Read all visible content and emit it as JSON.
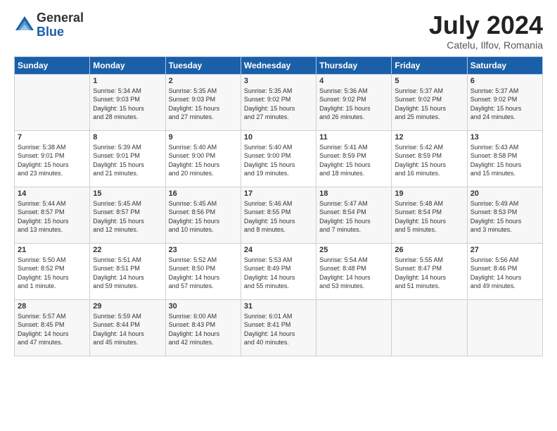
{
  "header": {
    "logo_general": "General",
    "logo_blue": "Blue",
    "month_title": "July 2024",
    "location": "Catelu, Ilfov, Romania"
  },
  "weekdays": [
    "Sunday",
    "Monday",
    "Tuesday",
    "Wednesday",
    "Thursday",
    "Friday",
    "Saturday"
  ],
  "weeks": [
    [
      {
        "day": "",
        "info": ""
      },
      {
        "day": "1",
        "info": "Sunrise: 5:34 AM\nSunset: 9:03 PM\nDaylight: 15 hours\nand 28 minutes."
      },
      {
        "day": "2",
        "info": "Sunrise: 5:35 AM\nSunset: 9:03 PM\nDaylight: 15 hours\nand 27 minutes."
      },
      {
        "day": "3",
        "info": "Sunrise: 5:35 AM\nSunset: 9:02 PM\nDaylight: 15 hours\nand 27 minutes."
      },
      {
        "day": "4",
        "info": "Sunrise: 5:36 AM\nSunset: 9:02 PM\nDaylight: 15 hours\nand 26 minutes."
      },
      {
        "day": "5",
        "info": "Sunrise: 5:37 AM\nSunset: 9:02 PM\nDaylight: 15 hours\nand 25 minutes."
      },
      {
        "day": "6",
        "info": "Sunrise: 5:37 AM\nSunset: 9:02 PM\nDaylight: 15 hours\nand 24 minutes."
      }
    ],
    [
      {
        "day": "7",
        "info": "Sunrise: 5:38 AM\nSunset: 9:01 PM\nDaylight: 15 hours\nand 23 minutes."
      },
      {
        "day": "8",
        "info": "Sunrise: 5:39 AM\nSunset: 9:01 PM\nDaylight: 15 hours\nand 21 minutes."
      },
      {
        "day": "9",
        "info": "Sunrise: 5:40 AM\nSunset: 9:00 PM\nDaylight: 15 hours\nand 20 minutes."
      },
      {
        "day": "10",
        "info": "Sunrise: 5:40 AM\nSunset: 9:00 PM\nDaylight: 15 hours\nand 19 minutes."
      },
      {
        "day": "11",
        "info": "Sunrise: 5:41 AM\nSunset: 8:59 PM\nDaylight: 15 hours\nand 18 minutes."
      },
      {
        "day": "12",
        "info": "Sunrise: 5:42 AM\nSunset: 8:59 PM\nDaylight: 15 hours\nand 16 minutes."
      },
      {
        "day": "13",
        "info": "Sunrise: 5:43 AM\nSunset: 8:58 PM\nDaylight: 15 hours\nand 15 minutes."
      }
    ],
    [
      {
        "day": "14",
        "info": "Sunrise: 5:44 AM\nSunset: 8:57 PM\nDaylight: 15 hours\nand 13 minutes."
      },
      {
        "day": "15",
        "info": "Sunrise: 5:45 AM\nSunset: 8:57 PM\nDaylight: 15 hours\nand 12 minutes."
      },
      {
        "day": "16",
        "info": "Sunrise: 5:45 AM\nSunset: 8:56 PM\nDaylight: 15 hours\nand 10 minutes."
      },
      {
        "day": "17",
        "info": "Sunrise: 5:46 AM\nSunset: 8:55 PM\nDaylight: 15 hours\nand 8 minutes."
      },
      {
        "day": "18",
        "info": "Sunrise: 5:47 AM\nSunset: 8:54 PM\nDaylight: 15 hours\nand 7 minutes."
      },
      {
        "day": "19",
        "info": "Sunrise: 5:48 AM\nSunset: 8:54 PM\nDaylight: 15 hours\nand 5 minutes."
      },
      {
        "day": "20",
        "info": "Sunrise: 5:49 AM\nSunset: 8:53 PM\nDaylight: 15 hours\nand 3 minutes."
      }
    ],
    [
      {
        "day": "21",
        "info": "Sunrise: 5:50 AM\nSunset: 8:52 PM\nDaylight: 15 hours\nand 1 minute."
      },
      {
        "day": "22",
        "info": "Sunrise: 5:51 AM\nSunset: 8:51 PM\nDaylight: 14 hours\nand 59 minutes."
      },
      {
        "day": "23",
        "info": "Sunrise: 5:52 AM\nSunset: 8:50 PM\nDaylight: 14 hours\nand 57 minutes."
      },
      {
        "day": "24",
        "info": "Sunrise: 5:53 AM\nSunset: 8:49 PM\nDaylight: 14 hours\nand 55 minutes."
      },
      {
        "day": "25",
        "info": "Sunrise: 5:54 AM\nSunset: 8:48 PM\nDaylight: 14 hours\nand 53 minutes."
      },
      {
        "day": "26",
        "info": "Sunrise: 5:55 AM\nSunset: 8:47 PM\nDaylight: 14 hours\nand 51 minutes."
      },
      {
        "day": "27",
        "info": "Sunrise: 5:56 AM\nSunset: 8:46 PM\nDaylight: 14 hours\nand 49 minutes."
      }
    ],
    [
      {
        "day": "28",
        "info": "Sunrise: 5:57 AM\nSunset: 8:45 PM\nDaylight: 14 hours\nand 47 minutes."
      },
      {
        "day": "29",
        "info": "Sunrise: 5:59 AM\nSunset: 8:44 PM\nDaylight: 14 hours\nand 45 minutes."
      },
      {
        "day": "30",
        "info": "Sunrise: 6:00 AM\nSunset: 8:43 PM\nDaylight: 14 hours\nand 42 minutes."
      },
      {
        "day": "31",
        "info": "Sunrise: 6:01 AM\nSunset: 8:41 PM\nDaylight: 14 hours\nand 40 minutes."
      },
      {
        "day": "",
        "info": ""
      },
      {
        "day": "",
        "info": ""
      },
      {
        "day": "",
        "info": ""
      }
    ]
  ]
}
